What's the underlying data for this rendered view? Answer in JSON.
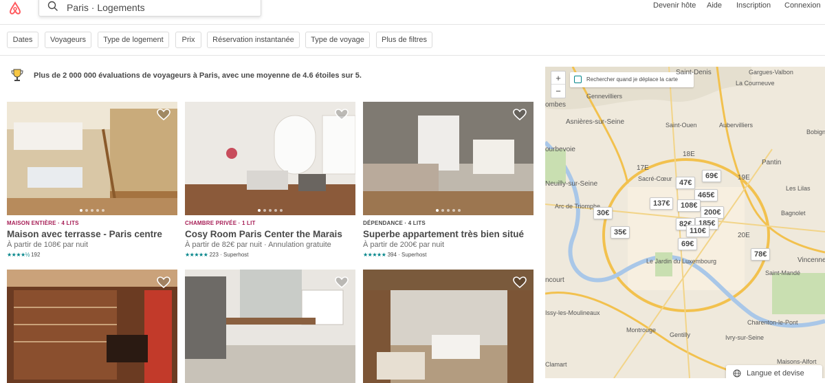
{
  "header": {
    "search_value": "Paris · Logements",
    "nav": [
      "Devenir hôte",
      "Aide",
      "Inscription",
      "Connexion"
    ]
  },
  "filters": [
    "Dates",
    "Voyageurs",
    "Type de logement",
    "Prix",
    "Réservation instantanée",
    "Type de voyage",
    "Plus de filtres"
  ],
  "banner": {
    "icon": "trophy-icon",
    "text": "Plus de 2 000 000 évaluations de voyageurs à Paris, avec une moyenne de 4.6 étoiles sur 5."
  },
  "listings": [
    {
      "kind": "MAISON ENTIÈRE · 4 LITS",
      "kind_color": "#a61d55",
      "title": "Maison avec terrasse - Paris centre",
      "price": "À partir de 108€  par nuit",
      "stars": "★★★★½",
      "reviews": "192"
    },
    {
      "kind": "CHAMBRE PRIVÉE · 1 LIT",
      "kind_color": "#a61d55",
      "title": "Cosy Room Paris Center the Marais",
      "price": "À partir de 82€  par nuit · Annulation gratuite",
      "stars": "★★★★★",
      "reviews": "223 · Superhost"
    },
    {
      "kind": "DÉPENDANCE · 4 LITS",
      "kind_color": "#484848",
      "title": "Superbe appartement très bien situé",
      "price": "À partir de 200€  par nuit",
      "stars": "★★★★★",
      "reviews": "394 · Superhost"
    },
    {
      "kind": "",
      "title": "",
      "price": "",
      "stars": "",
      "reviews": ""
    },
    {
      "kind": "",
      "title": "",
      "price": "",
      "stars": "",
      "reviews": ""
    },
    {
      "kind": "",
      "title": "",
      "price": "",
      "stars": "",
      "reviews": ""
    }
  ],
  "map": {
    "zoom_in": "+",
    "zoom_out": "−",
    "search_on_move": "Rechercher quand je déplace la carte",
    "pins": [
      "69€",
      "47€",
      "465€",
      "137€",
      "108€",
      "200€",
      "30€",
      "82€",
      "185€",
      "110€",
      "35€",
      "69€",
      "78€"
    ],
    "labels": [
      "Gennevilliers",
      "Saint-Denis",
      "Gargues-Valbon",
      "La Courneuve",
      "Asnières-sur-Seine",
      "Saint-Ouen",
      "Aubervilliers",
      "Bobigny",
      "ourbevoie",
      "Pantin",
      "Neuilly-sur-Seine",
      "Sacré-Cœur",
      "Les Lilas",
      "Arc de Triomphe",
      "Bagnolet",
      "Le Jardin du Luxembourg",
      "Vincennes",
      "Saint-Mandé",
      "Issy-les-Moulineaux",
      "Montrouge",
      "Charenton-le-Pont",
      "Ivry-sur-Seine",
      "Gentilly",
      "Maisons-Alfort",
      "Clamart",
      "17E",
      "18E",
      "20E",
      "19E",
      "ombes",
      "ncourt"
    ],
    "lang_button": "Langue et devise"
  }
}
